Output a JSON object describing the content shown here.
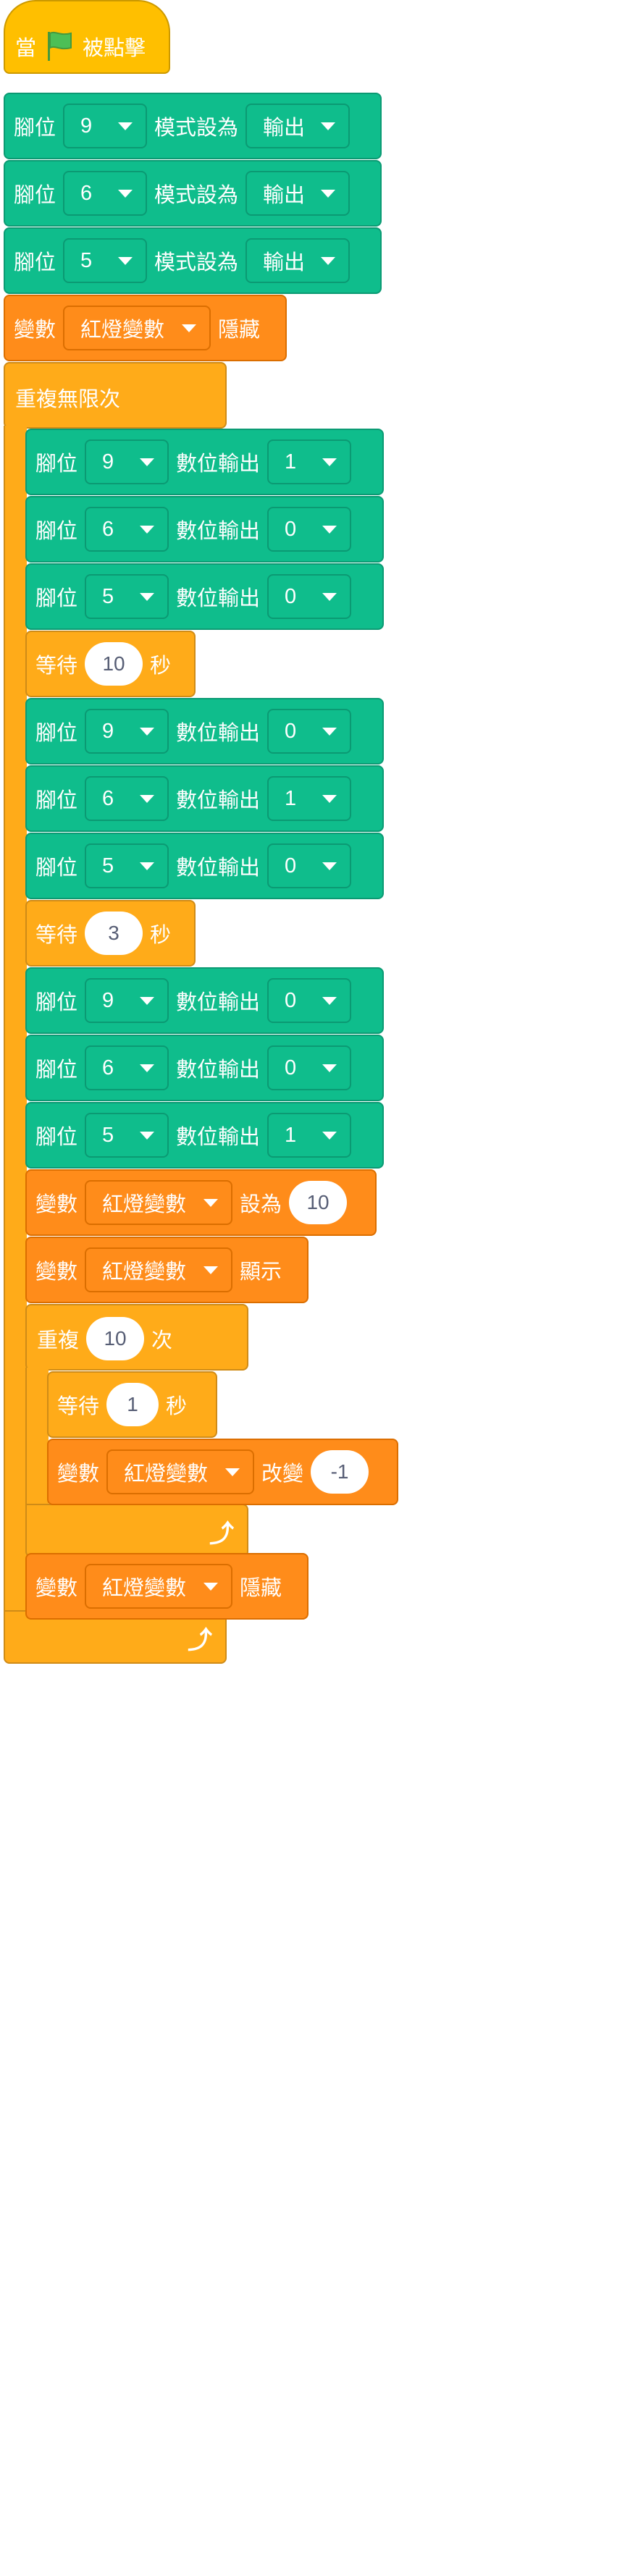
{
  "script": {
    "hat": {
      "prefix": "當",
      "suffix": "被點擊",
      "icon": "green-flag-icon"
    },
    "setup": [
      {
        "pin_label": "腳位",
        "pin": "9",
        "mode_label": "模式設為",
        "mode": "輸出"
      },
      {
        "pin_label": "腳位",
        "pin": "6",
        "mode_label": "模式設為",
        "mode": "輸出"
      },
      {
        "pin_label": "腳位",
        "pin": "5",
        "mode_label": "模式設為",
        "mode": "輸出"
      }
    ],
    "hide_var_1": {
      "prefix": "變數",
      "var": "紅燈變數",
      "action": "隱藏"
    },
    "forever": {
      "label": "重複無限次"
    },
    "seq1": [
      {
        "pin_label": "腳位",
        "pin": "9",
        "out_label": "數位輸出",
        "value": "1"
      },
      {
        "pin_label": "腳位",
        "pin": "6",
        "out_label": "數位輸出",
        "value": "0"
      },
      {
        "pin_label": "腳位",
        "pin": "5",
        "out_label": "數位輸出",
        "value": "0"
      }
    ],
    "wait1": {
      "prefix": "等待",
      "value": "10",
      "suffix": "秒"
    },
    "seq2": [
      {
        "pin_label": "腳位",
        "pin": "9",
        "out_label": "數位輸出",
        "value": "0"
      },
      {
        "pin_label": "腳位",
        "pin": "6",
        "out_label": "數位輸出",
        "value": "1"
      },
      {
        "pin_label": "腳位",
        "pin": "5",
        "out_label": "數位輸出",
        "value": "0"
      }
    ],
    "wait2": {
      "prefix": "等待",
      "value": "3",
      "suffix": "秒"
    },
    "seq3": [
      {
        "pin_label": "腳位",
        "pin": "9",
        "out_label": "數位輸出",
        "value": "0"
      },
      {
        "pin_label": "腳位",
        "pin": "6",
        "out_label": "數位輸出",
        "value": "0"
      },
      {
        "pin_label": "腳位",
        "pin": "5",
        "out_label": "數位輸出",
        "value": "1"
      }
    ],
    "set_var": {
      "prefix": "變數",
      "var": "紅燈變數",
      "action": "設為",
      "value": "10"
    },
    "show_var": {
      "prefix": "變數",
      "var": "紅燈變數",
      "action": "顯示"
    },
    "repeat": {
      "prefix": "重複",
      "value": "10",
      "suffix": "次"
    },
    "wait3": {
      "prefix": "等待",
      "value": "1",
      "suffix": "秒"
    },
    "change_var": {
      "prefix": "變數",
      "var": "紅燈變數",
      "action": "改變",
      "value": "-1"
    },
    "hide_var_2": {
      "prefix": "變數",
      "var": "紅燈變數",
      "action": "隱藏"
    }
  },
  "colors": {
    "events": "#FFBF00",
    "arduino": "#0FBD8C",
    "variables": "#FF8C1A",
    "control": "#FFAB19"
  }
}
